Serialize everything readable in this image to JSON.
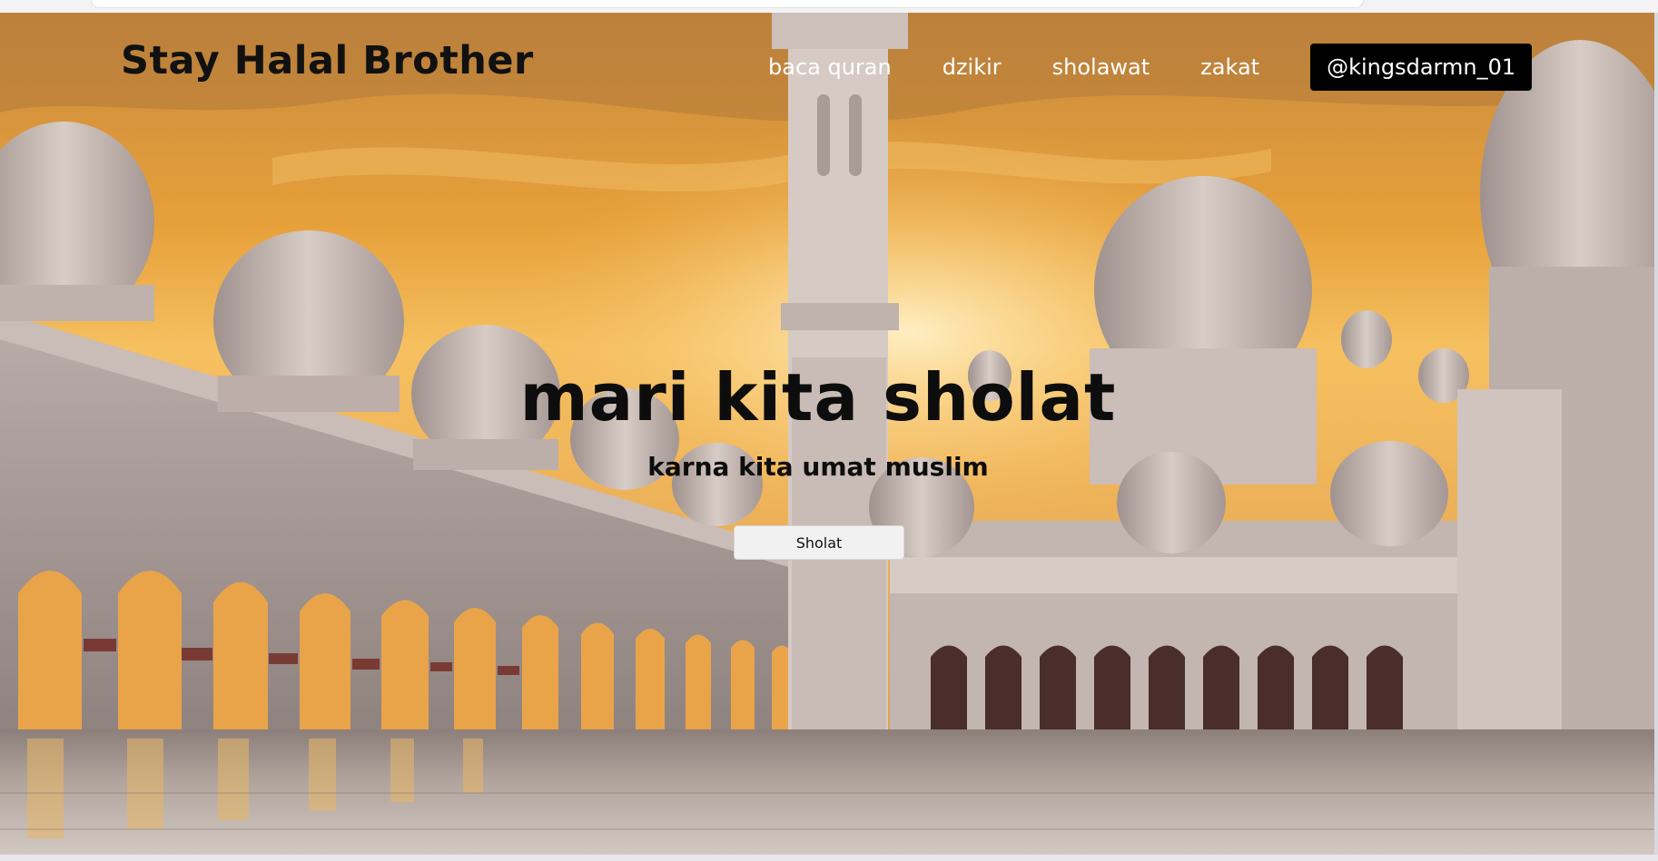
{
  "header": {
    "brand": "Stay Halal Brother",
    "nav": [
      {
        "label": "baca quran"
      },
      {
        "label": "dzikir"
      },
      {
        "label": "sholawat"
      },
      {
        "label": "zakat"
      }
    ],
    "handle": "@kingsdarmn_01"
  },
  "hero": {
    "title": "mari kita sholat",
    "subtitle": "karna kita umat muslim",
    "button_label": "Sholat",
    "background_image": "mosque-courtyard-at-sunset"
  },
  "colors": {
    "sky": "#e8a63c",
    "text_dark": "#0d0d0d",
    "nav_text": "#ffffff",
    "handle_bg": "#000000",
    "button_bg": "#f1f1f1"
  }
}
